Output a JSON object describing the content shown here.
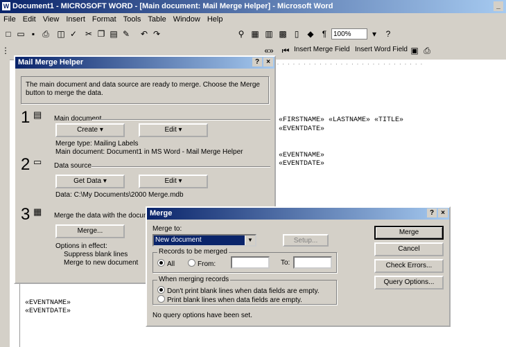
{
  "window": {
    "title": "Document1 - MICROSOFT WORD - [Main document: Mail Merge Helper] - Microsoft Word",
    "close_glyph": "_ ×"
  },
  "menu": [
    "File",
    "Edit",
    "View",
    "Insert",
    "Format",
    "Tools",
    "Table",
    "Window",
    "Help"
  ],
  "toolbar": {
    "zoom_value": "100%",
    "merge_field_label": "Insert Merge Field",
    "insert_word_field_label": "Insert Word Field"
  },
  "document": {
    "lines_main": [
      "«FIRSTNAME» «LASTNAME» «TITLE»",
      "«EVENTDATE»",
      "«EVENTNAME»",
      "«EVENTDATE»"
    ],
    "lines_lower": [
      "«EVENTNAME»",
      "«EVENTDATE»"
    ]
  },
  "mail_merge_helper": {
    "title": "Mail Merge Helper",
    "intro": "The main document and data source are ready to merge. Choose the Merge button to merge the data.",
    "step1": {
      "number": "1",
      "label": "Main document",
      "create_button": "Create ▾",
      "edit_button": "Edit ▾",
      "info_line1": "Merge type: Mailing Labels",
      "info_line2": "Main document: Document1 in MS Word - Mail Merge Helper"
    },
    "step2": {
      "number": "2",
      "label": "Data source",
      "get_data_button": "Get Data ▾",
      "edit_button": "Edit ▾",
      "info_line1": "Data: C:\\My Documents\\2000 Merge.mdb"
    },
    "step3": {
      "number": "3",
      "label": "Merge the data with the document",
      "merge_button": "Merge...",
      "query_button": "Query Options...",
      "info_line1": "Options in effect:",
      "info_line2": "Suppress blank lines",
      "info_line3": "Merge to new document"
    }
  },
  "merge_dialog": {
    "title": "Merge",
    "merge_to_label": "Merge to:",
    "merge_to_value": "New document",
    "setup_button": "Setup...",
    "records_group_label": "Records to be merged",
    "radio_all": "All",
    "radio_from": "From:",
    "to_label": "To:",
    "blank_group_label": "When merging records",
    "blank_option1": "Don't print blank lines when data fields are empty.",
    "blank_option2": "Print blank lines when data fields are empty.",
    "status": "No query options have been set.",
    "buttons": {
      "merge": "Merge",
      "cancel": "Cancel",
      "check_errors": "Check Errors...",
      "query_options": "Query Options..."
    }
  }
}
